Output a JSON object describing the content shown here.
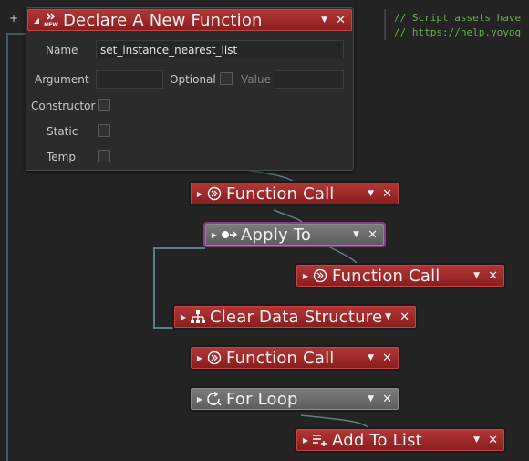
{
  "expander": "+",
  "comment": {
    "line1": "// Script assets have",
    "line2": "// https://help.yoyog"
  },
  "declare": {
    "new_badge": "NEW",
    "title": "Declare A New Function",
    "name_label": "Name",
    "name_value": "set_instance_nearest_list",
    "argument_label": "Argument",
    "argument_value": "",
    "optional_label": "Optional",
    "value_label": "Value",
    "value_value": "",
    "constructor_label": "Constructor",
    "static_label": "Static",
    "temp_label": "Temp"
  },
  "nodes": [
    {
      "label": "Function Call",
      "icon": "function-call-icon",
      "color": "red"
    },
    {
      "label": "Apply To",
      "icon": "apply-to-icon",
      "color": "gray"
    },
    {
      "label": "Function Call",
      "icon": "function-call-icon",
      "color": "red"
    },
    {
      "label": "Clear Data Structure",
      "icon": "data-structure-icon",
      "color": "red"
    },
    {
      "label": "Function Call",
      "icon": "function-call-icon",
      "color": "red"
    },
    {
      "label": "For Loop",
      "icon": "for-loop-icon",
      "color": "gray"
    },
    {
      "label": "Add To List",
      "icon": "add-to-list-icon",
      "color": "red"
    }
  ],
  "glyphs": {
    "dropdown": "▼",
    "close": "✕",
    "collapsed": "▶",
    "expanded": "◢"
  },
  "colors": {
    "red_header": "#9e2a2a",
    "gray_header": "#6a6a6a",
    "background": "#232323",
    "comment": "#66b14d",
    "wire": "#5c7f86"
  }
}
